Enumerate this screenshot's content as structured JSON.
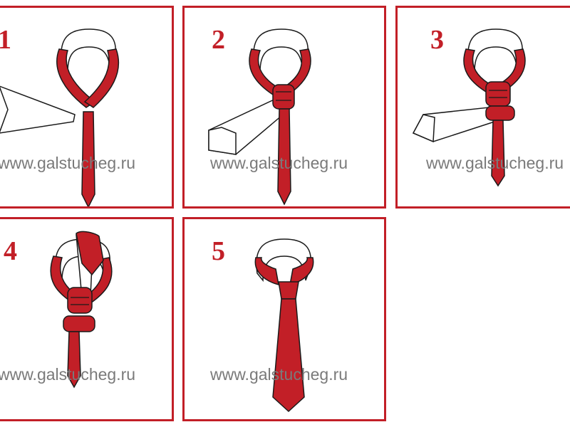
{
  "watermark": "www.galstucheg.ru",
  "colors": {
    "tie": "#c21f27",
    "border": "#c21f27",
    "outline": "#1a1a1a",
    "number": "#c21f27",
    "watermark": "#7a7a7a"
  },
  "steps": [
    {
      "number": "1"
    },
    {
      "number": "2"
    },
    {
      "number": "3"
    },
    {
      "number": "4"
    },
    {
      "number": "5"
    }
  ]
}
